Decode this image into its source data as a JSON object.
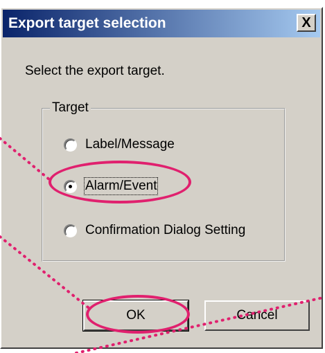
{
  "dialog": {
    "title": "Export target selection",
    "close_label": "X",
    "prompt": "Select the export target."
  },
  "target_group": {
    "legend": "Target",
    "options": [
      {
        "label": "Label/Message",
        "checked": false
      },
      {
        "label": "Alarm/Event",
        "checked": true
      },
      {
        "label": "Confirmation Dialog Setting",
        "checked": false
      }
    ]
  },
  "buttons": {
    "ok_label": "OK",
    "cancel_label": "Cancel"
  },
  "annotation": {
    "highlight_color": "#e0206e"
  }
}
